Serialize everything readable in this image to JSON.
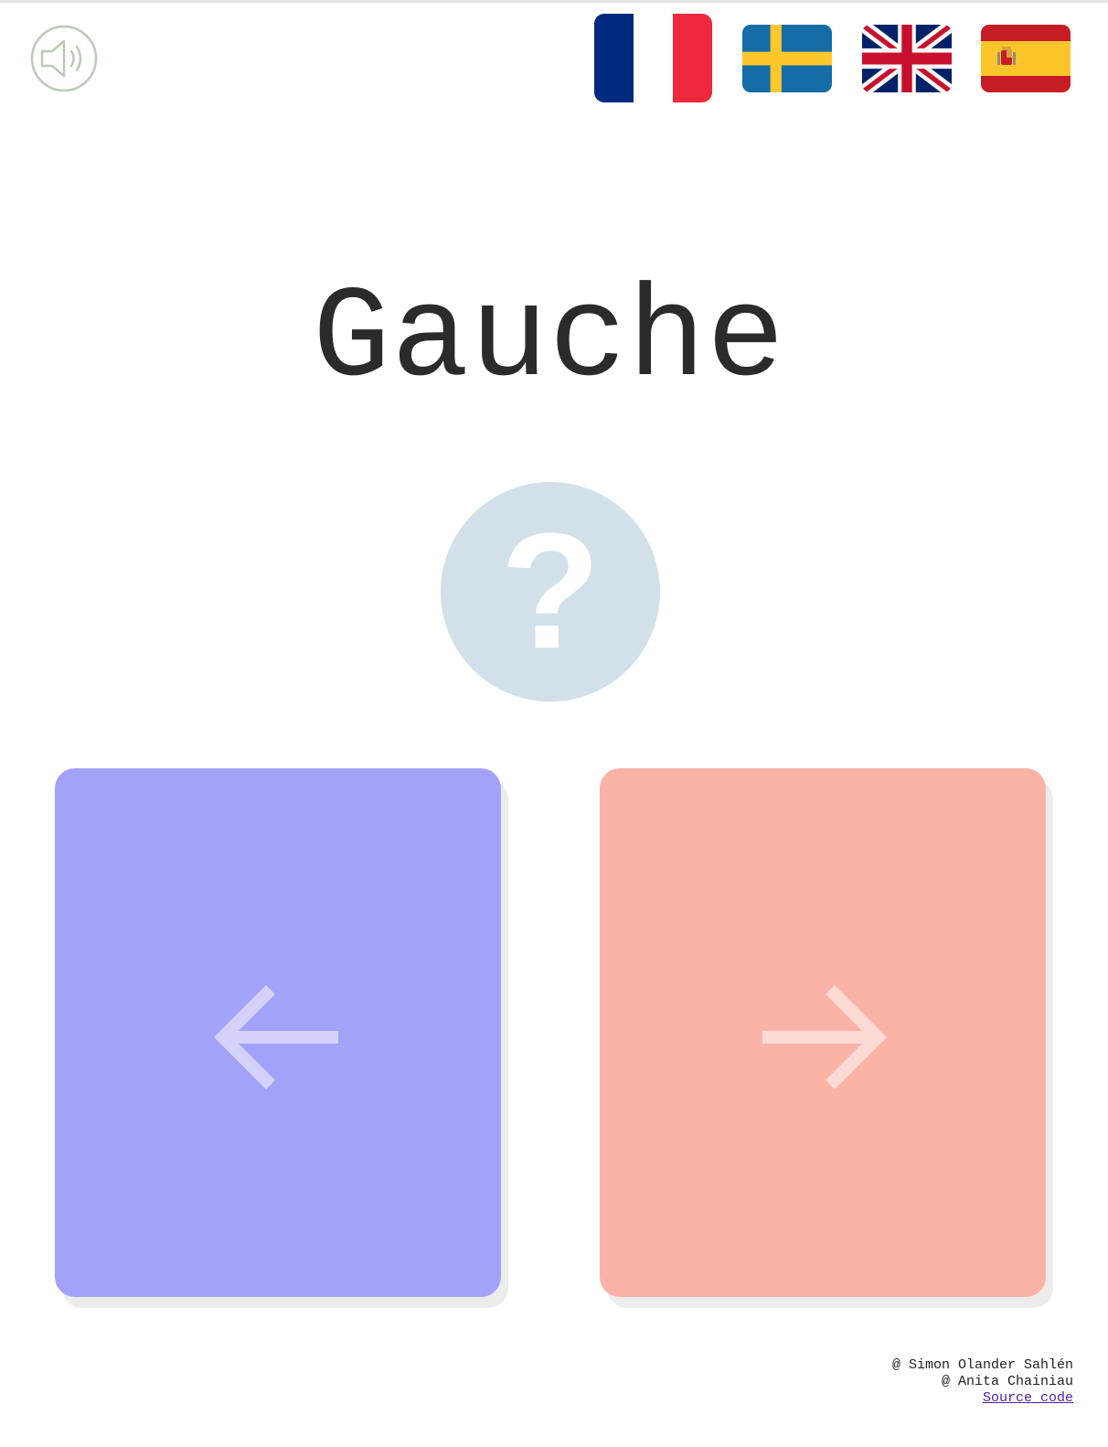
{
  "header": {
    "sound_icon": "speaker-icon",
    "languages": [
      {
        "code": "fr",
        "name": "French",
        "icon": "france-flag-icon",
        "selected": true
      },
      {
        "code": "sv",
        "name": "Swedish",
        "icon": "sweden-flag-icon",
        "selected": false
      },
      {
        "code": "en",
        "name": "English",
        "icon": "uk-flag-icon",
        "selected": false
      },
      {
        "code": "es",
        "name": "Spanish",
        "icon": "spain-flag-icon",
        "selected": false
      }
    ]
  },
  "quiz": {
    "word": "Gauche",
    "hint_symbol": "?",
    "choices": [
      {
        "direction": "left",
        "icon": "arrow-left-icon",
        "color": "#a2a2f9"
      },
      {
        "direction": "right",
        "icon": "arrow-right-icon",
        "color": "#fbb3a7"
      }
    ]
  },
  "colors": {
    "hint_circle": "#d2e0e9",
    "word_text": "#2b2b2b",
    "sound_icon": "#b9cbb3"
  },
  "footer": {
    "credit_1": "@ Simon Olander Sahlén",
    "credit_2": "@ Anita Chainiau",
    "source_link": "Source code"
  }
}
